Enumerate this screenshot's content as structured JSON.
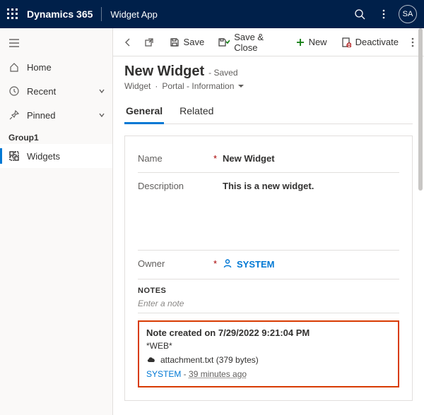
{
  "topbar": {
    "brand": "Dynamics 365",
    "app": "Widget App",
    "avatar": "SA"
  },
  "sidebar": {
    "home": "Home",
    "recent": "Recent",
    "pinned": "Pinned",
    "group": "Group1",
    "widgets": "Widgets"
  },
  "cmd": {
    "save": "Save",
    "saveClose": "Save & Close",
    "new": "New",
    "deactivate": "Deactivate"
  },
  "header": {
    "title": "New Widget",
    "status": "- Saved",
    "entity": "Widget",
    "form": "Portal - Information"
  },
  "tabs": {
    "general": "General",
    "related": "Related"
  },
  "fields": {
    "nameLabel": "Name",
    "nameValue": "New Widget",
    "descLabel": "Description",
    "descValue": "This is a new widget.",
    "ownerLabel": "Owner",
    "ownerValue": "SYSTEM"
  },
  "notes": {
    "heading": "NOTES",
    "placeholder": "Enter a note",
    "title": "Note created on 7/29/2022 9:21:04 PM",
    "source": "*WEB*",
    "attachment": "attachment.txt (379 bytes)",
    "author": "SYSTEM",
    "sep": " - ",
    "ago": "39 minutes ago"
  }
}
